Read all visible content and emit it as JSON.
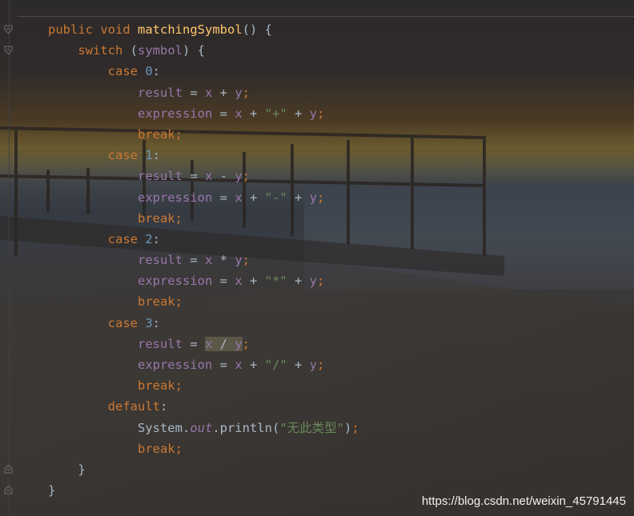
{
  "code": {
    "lines": [
      {
        "tokens": [
          {
            "t": "public ",
            "c": "kw"
          },
          {
            "t": "void ",
            "c": "kw"
          },
          {
            "t": "matchingSymbol",
            "c": "fn"
          },
          {
            "t": "() {",
            "c": "plain"
          }
        ]
      },
      {
        "tokens": [
          {
            "t": "    ",
            "c": "plain"
          },
          {
            "t": "switch ",
            "c": "kw"
          },
          {
            "t": "(",
            "c": "plain"
          },
          {
            "t": "symbol",
            "c": "field"
          },
          {
            "t": ") {",
            "c": "plain"
          }
        ]
      },
      {
        "tokens": [
          {
            "t": "        ",
            "c": "plain"
          },
          {
            "t": "case ",
            "c": "kw"
          },
          {
            "t": "0",
            "c": "num"
          },
          {
            "t": ":",
            "c": "plain"
          }
        ]
      },
      {
        "tokens": [
          {
            "t": "            ",
            "c": "plain"
          },
          {
            "t": "result",
            "c": "field"
          },
          {
            "t": " = ",
            "c": "plain"
          },
          {
            "t": "x",
            "c": "field"
          },
          {
            "t": " + ",
            "c": "plain"
          },
          {
            "t": "y",
            "c": "field"
          },
          {
            "t": ";",
            "c": "semi"
          }
        ]
      },
      {
        "tokens": [
          {
            "t": "            ",
            "c": "plain"
          },
          {
            "t": "expression",
            "c": "field"
          },
          {
            "t": " = ",
            "c": "plain"
          },
          {
            "t": "x",
            "c": "field"
          },
          {
            "t": " + ",
            "c": "plain"
          },
          {
            "t": "\"+\"",
            "c": "str"
          },
          {
            "t": " + ",
            "c": "plain"
          },
          {
            "t": "y",
            "c": "field"
          },
          {
            "t": ";",
            "c": "semi"
          }
        ]
      },
      {
        "tokens": [
          {
            "t": "            ",
            "c": "plain"
          },
          {
            "t": "break",
            "c": "kw"
          },
          {
            "t": ";",
            "c": "semi"
          }
        ]
      },
      {
        "tokens": [
          {
            "t": "        ",
            "c": "plain"
          },
          {
            "t": "case ",
            "c": "kw"
          },
          {
            "t": "1",
            "c": "num"
          },
          {
            "t": ":",
            "c": "plain"
          }
        ]
      },
      {
        "tokens": [
          {
            "t": "            ",
            "c": "plain"
          },
          {
            "t": "result",
            "c": "field"
          },
          {
            "t": " = ",
            "c": "plain"
          },
          {
            "t": "x",
            "c": "field"
          },
          {
            "t": " - ",
            "c": "plain"
          },
          {
            "t": "y",
            "c": "field"
          },
          {
            "t": ";",
            "c": "semi"
          }
        ]
      },
      {
        "tokens": [
          {
            "t": "            ",
            "c": "plain"
          },
          {
            "t": "expression",
            "c": "field"
          },
          {
            "t": " = ",
            "c": "plain"
          },
          {
            "t": "x",
            "c": "field"
          },
          {
            "t": " + ",
            "c": "plain"
          },
          {
            "t": "\"-\"",
            "c": "str"
          },
          {
            "t": " + ",
            "c": "plain"
          },
          {
            "t": "y",
            "c": "field"
          },
          {
            "t": ";",
            "c": "semi"
          }
        ]
      },
      {
        "tokens": [
          {
            "t": "            ",
            "c": "plain"
          },
          {
            "t": "break",
            "c": "kw"
          },
          {
            "t": ";",
            "c": "semi"
          }
        ]
      },
      {
        "tokens": [
          {
            "t": "        ",
            "c": "plain"
          },
          {
            "t": "case ",
            "c": "kw"
          },
          {
            "t": "2",
            "c": "num"
          },
          {
            "t": ":",
            "c": "plain"
          }
        ]
      },
      {
        "tokens": [
          {
            "t": "            ",
            "c": "plain"
          },
          {
            "t": "result",
            "c": "field"
          },
          {
            "t": " = ",
            "c": "plain"
          },
          {
            "t": "x",
            "c": "field"
          },
          {
            "t": " * ",
            "c": "plain"
          },
          {
            "t": "y",
            "c": "field"
          },
          {
            "t": ";",
            "c": "semi"
          }
        ]
      },
      {
        "tokens": [
          {
            "t": "            ",
            "c": "plain"
          },
          {
            "t": "expression",
            "c": "field"
          },
          {
            "t": " = ",
            "c": "plain"
          },
          {
            "t": "x",
            "c": "field"
          },
          {
            "t": " + ",
            "c": "plain"
          },
          {
            "t": "\"*\"",
            "c": "str"
          },
          {
            "t": " + ",
            "c": "plain"
          },
          {
            "t": "y",
            "c": "field"
          },
          {
            "t": ";",
            "c": "semi"
          }
        ]
      },
      {
        "tokens": [
          {
            "t": "            ",
            "c": "plain"
          },
          {
            "t": "break",
            "c": "kw"
          },
          {
            "t": ";",
            "c": "semi"
          }
        ]
      },
      {
        "tokens": [
          {
            "t": "        ",
            "c": "plain"
          },
          {
            "t": "case ",
            "c": "kw"
          },
          {
            "t": "3",
            "c": "num"
          },
          {
            "t": ":",
            "c": "plain"
          }
        ]
      },
      {
        "tokens": [
          {
            "t": "            ",
            "c": "plain"
          },
          {
            "t": "result",
            "c": "field"
          },
          {
            "t": " = ",
            "c": "plain"
          },
          {
            "t": "x",
            "c": "field",
            "hl": true
          },
          {
            "t": " / ",
            "c": "plain",
            "hl": true
          },
          {
            "t": "y",
            "c": "field",
            "hl": true
          },
          {
            "t": ";",
            "c": "semi"
          }
        ]
      },
      {
        "tokens": [
          {
            "t": "            ",
            "c": "plain"
          },
          {
            "t": "expression",
            "c": "field"
          },
          {
            "t": " = ",
            "c": "plain"
          },
          {
            "t": "x",
            "c": "field"
          },
          {
            "t": " + ",
            "c": "plain"
          },
          {
            "t": "\"/\"",
            "c": "str"
          },
          {
            "t": " + ",
            "c": "plain"
          },
          {
            "t": "y",
            "c": "field"
          },
          {
            "t": ";",
            "c": "semi"
          }
        ]
      },
      {
        "tokens": [
          {
            "t": "            ",
            "c": "plain"
          },
          {
            "t": "break",
            "c": "kw"
          },
          {
            "t": ";",
            "c": "semi"
          }
        ]
      },
      {
        "tokens": [
          {
            "t": "        ",
            "c": "plain"
          },
          {
            "t": "default",
            "c": "kw"
          },
          {
            "t": ":",
            "c": "plain"
          }
        ]
      },
      {
        "tokens": [
          {
            "t": "            ",
            "c": "plain"
          },
          {
            "t": "System.",
            "c": "plain"
          },
          {
            "t": "out",
            "c": "italic"
          },
          {
            "t": ".println(",
            "c": "plain"
          },
          {
            "t": "\"无此类型\"",
            "c": "str"
          },
          {
            "t": ")",
            "c": "plain"
          },
          {
            "t": ";",
            "c": "semi"
          }
        ]
      },
      {
        "tokens": [
          {
            "t": "            ",
            "c": "plain"
          },
          {
            "t": "break",
            "c": "kw"
          },
          {
            "t": ";",
            "c": "semi"
          }
        ]
      },
      {
        "tokens": [
          {
            "t": "    ",
            "c": "plain"
          },
          {
            "t": "}",
            "c": "plain"
          }
        ]
      },
      {
        "tokens": [
          {
            "t": "}",
            "c": "plain"
          }
        ]
      }
    ]
  },
  "watermark": "https://blog.csdn.net/weixin_45791445",
  "colors": {
    "keyword": "#cc7832",
    "method": "#ffc66d",
    "field": "#9876aa",
    "number": "#6897bb",
    "string": "#6a8759",
    "text": "#a9b7c6"
  }
}
